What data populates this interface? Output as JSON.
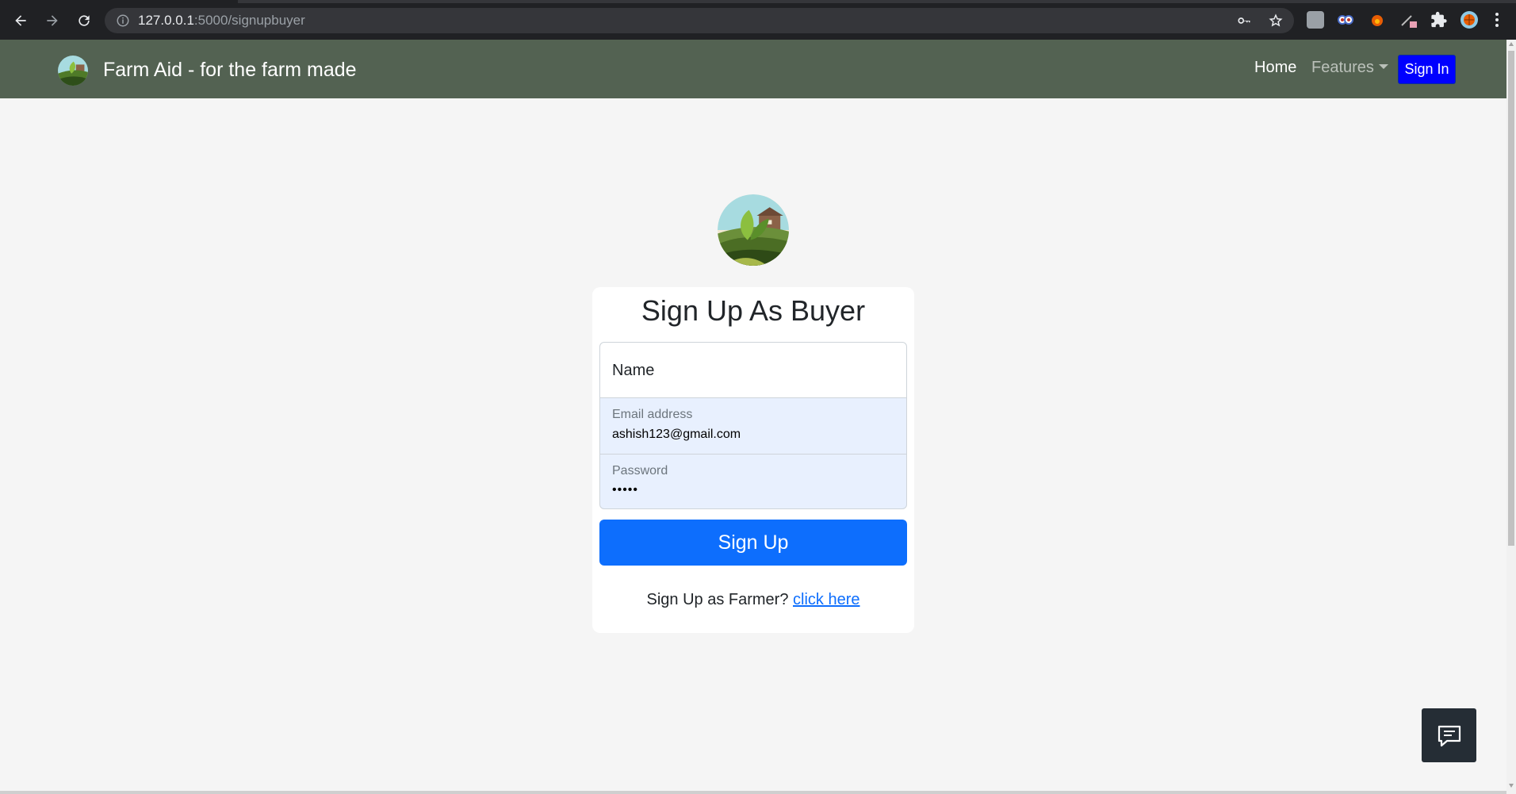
{
  "browser": {
    "url_host": "127.0.0.1",
    "url_path": ":5000/signupbuyer"
  },
  "navbar": {
    "brand": "Farm Aid - for the farm made",
    "home": "Home",
    "features": "Features",
    "signin": "Sign In"
  },
  "form": {
    "title": "Sign Up As Buyer",
    "name_placeholder": "Name",
    "email_label": "Email address",
    "email_value": "ashish123@gmail.com",
    "password_label": "Password",
    "password_value": "•••••",
    "submit": "Sign Up",
    "farmer_prompt": "Sign Up as Farmer?",
    "farmer_link": "click here"
  },
  "colors": {
    "navbar": "#536252",
    "signin": "#0000ff",
    "primary": "#0d6efd",
    "autofill": "#e8f0fe"
  }
}
